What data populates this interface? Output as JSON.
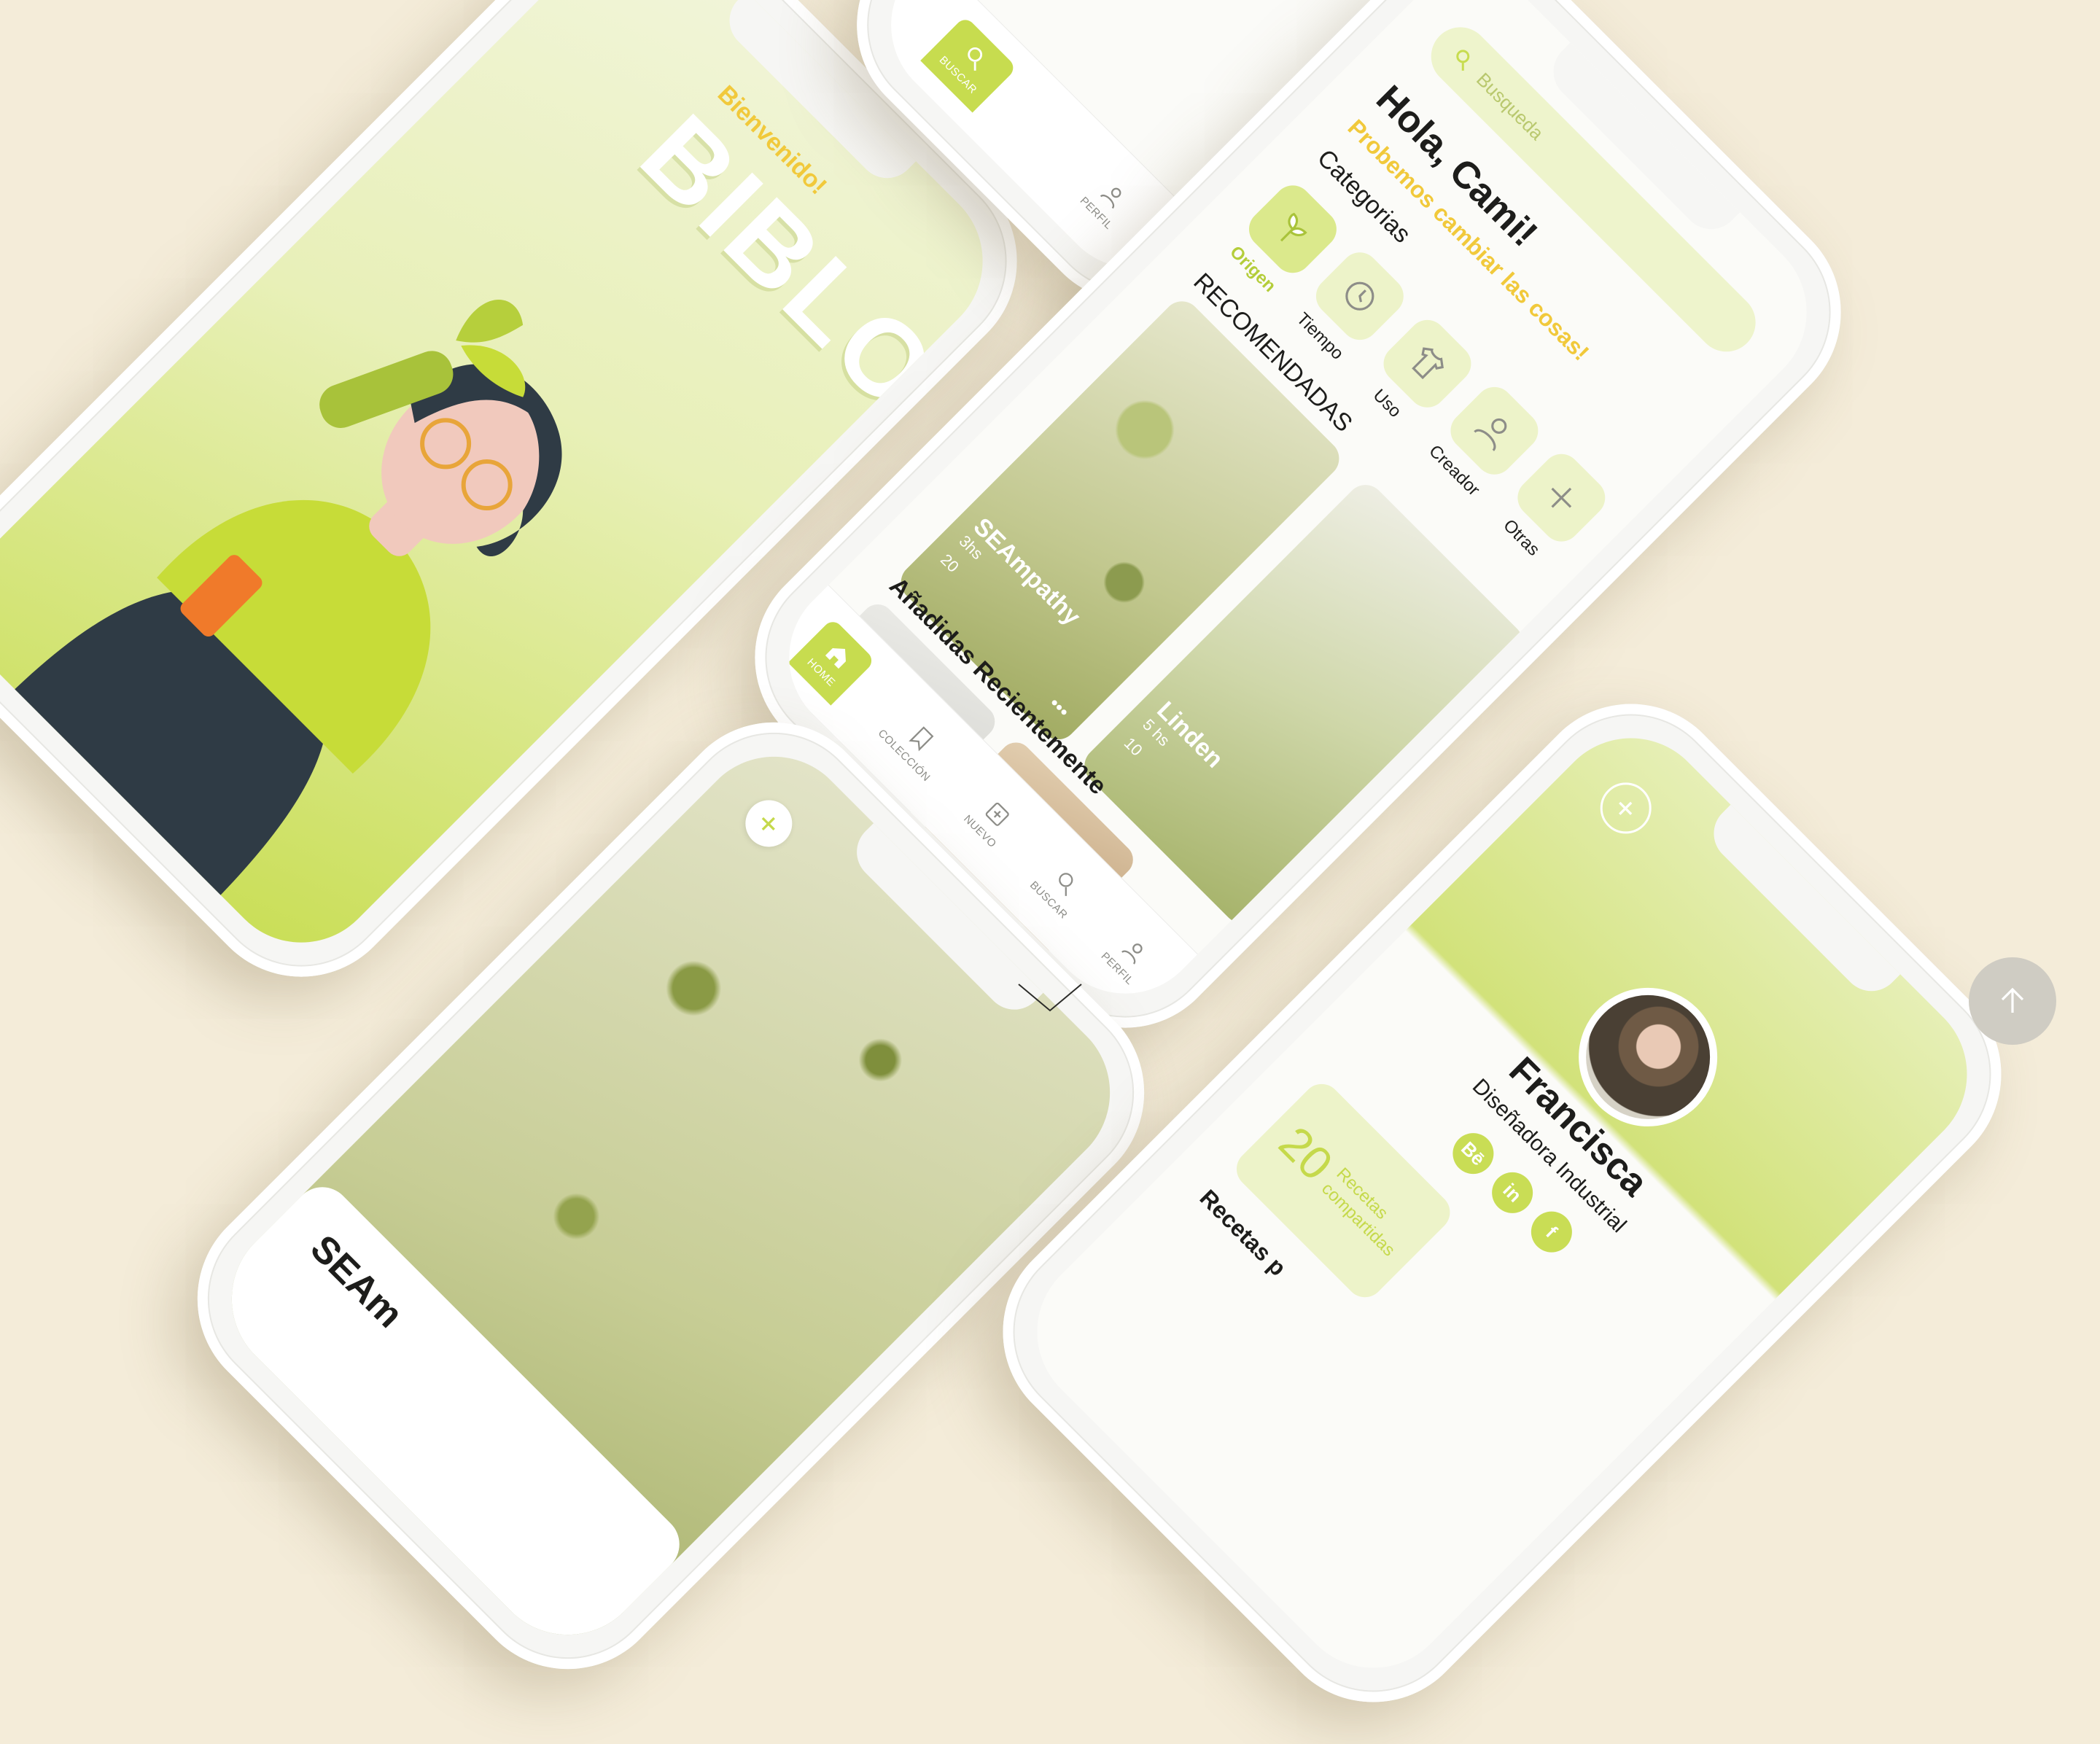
{
  "welcome_screen": {
    "greeting": "Bienvenido!",
    "app_name": "BIBLOS"
  },
  "home_screen": {
    "search_placeholder": "Busqueda",
    "greeting": "Hola, Cami!",
    "tagline": "Probemos cambiar las cosas!",
    "categories_title": "Categorias",
    "categories": [
      {
        "label": "Origen",
        "icon": "seedling-icon",
        "active": true
      },
      {
        "label": "Tiempo",
        "icon": "clock-icon",
        "active": false
      },
      {
        "label": "Uso",
        "icon": "tshirt-icon",
        "active": false
      },
      {
        "label": "Creador",
        "icon": "user-icon",
        "active": false
      },
      {
        "label": "Otras",
        "icon": "plus-icon",
        "active": false
      }
    ],
    "recommended_title": "RECOMENDADAS",
    "recommended": [
      {
        "title": "SEAmpathy",
        "duration": "3hs",
        "users": "20",
        "more": "•••"
      },
      {
        "title": "Linden",
        "duration": "5 hs",
        "users": "10"
      }
    ],
    "recent_title": "Añadidas Recientemente"
  },
  "tabbar": {
    "home": "HOME",
    "collection": "COLECCIÓN",
    "new": "NUEVO",
    "search": "BUSCAR",
    "profile": "PERFIL"
  },
  "top_phone": {
    "search_label": "BUSCAR",
    "profile_label": "PERFIL",
    "more": "•••"
  },
  "detail_screen": {
    "title": "SEAm",
    "add_symbol": "+"
  },
  "profile_screen": {
    "add_symbol": "+",
    "name": "Francisca",
    "role": "Diseñadora Industrial",
    "socials": [
      "Bē",
      "in",
      "f"
    ],
    "stat_number": "20",
    "stat_label": "Recetas compartidas",
    "recipes_title": "Recetas p"
  },
  "colors": {
    "background": "#f4ecd9",
    "accent_green": "#c7dc4f",
    "accent_yellow": "#f1c93b",
    "pale_green": "#edf3c9"
  }
}
